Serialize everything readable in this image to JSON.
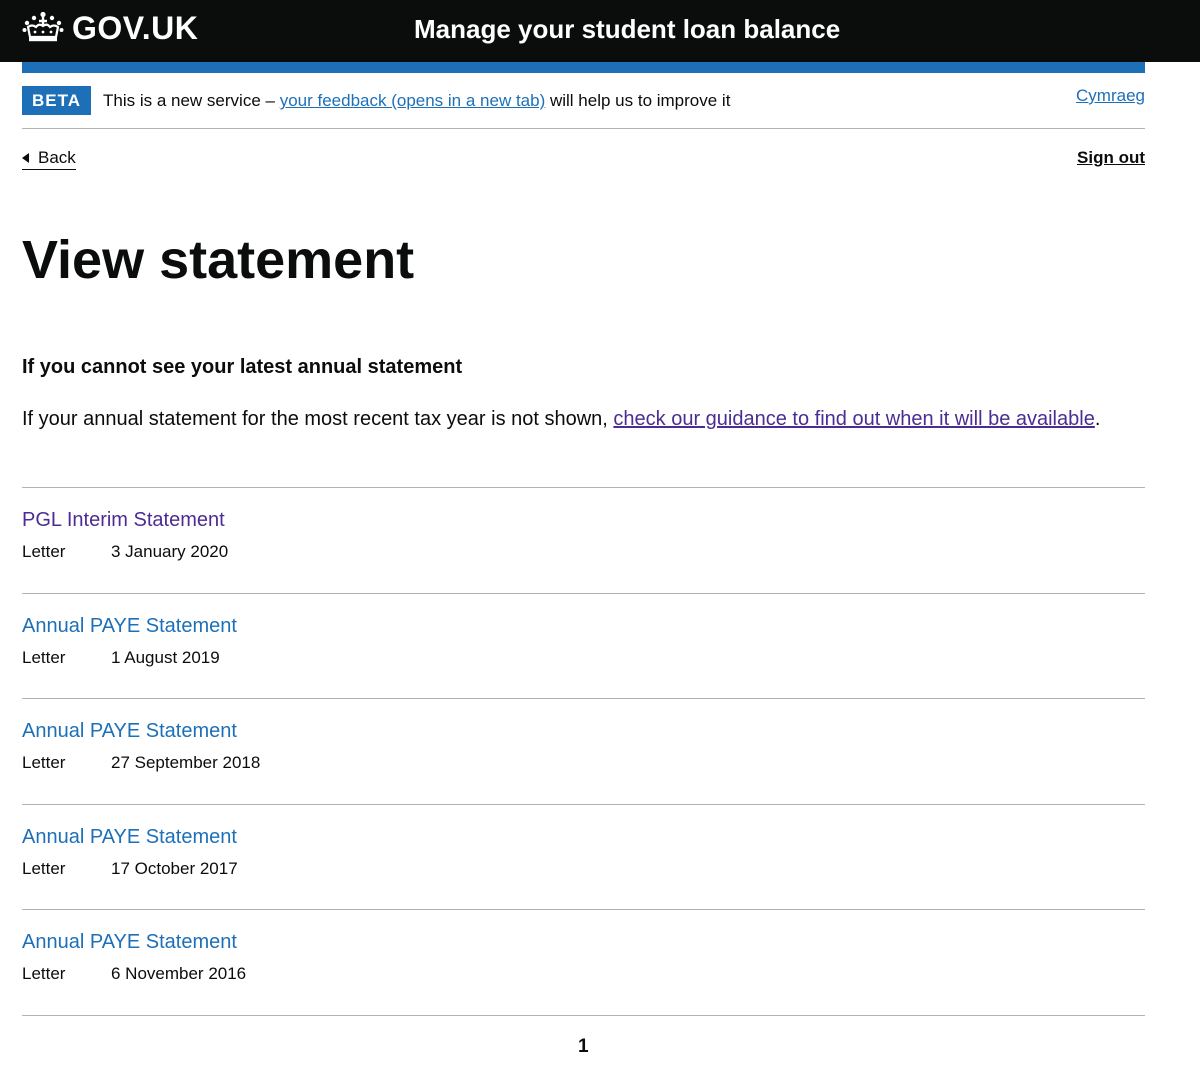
{
  "header": {
    "logo_text": "GOV.UK",
    "service_name": "Manage your student loan balance"
  },
  "phase_banner": {
    "tag": "BETA",
    "text_before": "This is a new service – ",
    "feedback_link": "your feedback (opens in a new tab)",
    "text_after": " will help us to improve it",
    "language_link": "Cymraeg"
  },
  "nav": {
    "back_label": "Back",
    "sign_out_label": "Sign out"
  },
  "main": {
    "title": "View statement",
    "subheading": "If you cannot see your latest annual statement",
    "body_before": "If your annual statement for the most recent tax year is not shown, ",
    "guidance_link": "check our guidance to find out when it will be available",
    "body_after": "."
  },
  "statements": [
    {
      "title": "PGL Interim Statement",
      "type": "Letter",
      "date": "3 January 2020",
      "visited": true
    },
    {
      "title": "Annual PAYE Statement",
      "type": "Letter",
      "date": "1 August 2019",
      "visited": false
    },
    {
      "title": "Annual PAYE Statement",
      "type": "Letter",
      "date": "27 September 2018",
      "visited": false
    },
    {
      "title": "Annual PAYE Statement",
      "type": "Letter",
      "date": "17 October 2017",
      "visited": false
    },
    {
      "title": "Annual PAYE Statement",
      "type": "Letter",
      "date": "6 November 2016",
      "visited": false
    }
  ],
  "pagination": {
    "current_page": "1"
  },
  "colors": {
    "header_bg": "#0b0c0c",
    "brand_blue": "#1d70b8",
    "visited_link": "#4c2c92",
    "border": "#b1b4b6"
  },
  "icons": {
    "logo": "crown-icon",
    "back": "chevron-left-icon"
  }
}
